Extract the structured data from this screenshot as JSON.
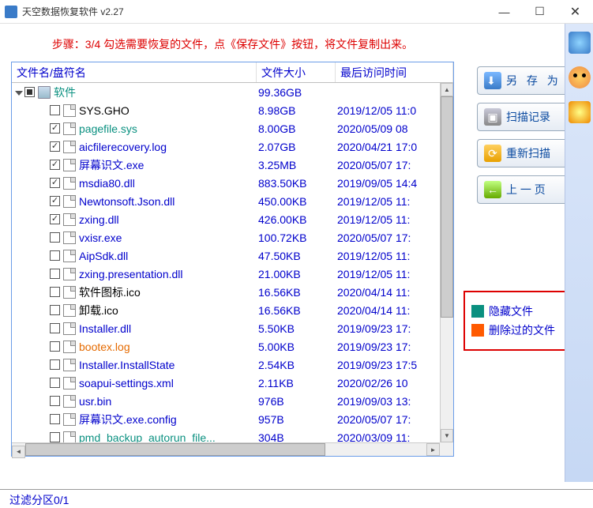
{
  "window": {
    "title": "天空数据恢复软件 v2.27"
  },
  "step_text": "步骤：3/4 勾选需要恢复的文件，点《保存文件》按钮，将文件复制出来。",
  "columns": {
    "name": "文件名/盘符名",
    "size": "文件大小",
    "time": "最后访问时间"
  },
  "root": {
    "label": "软件",
    "size": "99.36GB"
  },
  "files": [
    {
      "chk": "none",
      "name": "SYS.GHO",
      "size": "8.98GB",
      "time": "2019/12/05 11:0",
      "cls": "c-black"
    },
    {
      "chk": "checked",
      "name": "pagefile.sys",
      "size": "8.00GB",
      "time": "2020/05/09 08",
      "cls": "c-green"
    },
    {
      "chk": "checked",
      "name": "aicfilerecovery.log",
      "size": "2.07GB",
      "time": "2020/04/21 17:0",
      "cls": "c-blue"
    },
    {
      "chk": "checked",
      "name": "屏幕识文.exe",
      "size": "3.25MB",
      "time": "2020/05/07 17:",
      "cls": "c-blue"
    },
    {
      "chk": "checked",
      "name": "msdia80.dll",
      "size": "883.50KB",
      "time": "2019/09/05 14:4",
      "cls": "c-blue"
    },
    {
      "chk": "checked",
      "name": "Newtonsoft.Json.dll",
      "size": "450.00KB",
      "time": "2019/12/05 11:",
      "cls": "c-blue"
    },
    {
      "chk": "checked",
      "name": "zxing.dll",
      "size": "426.00KB",
      "time": "2019/12/05 11:",
      "cls": "c-blue"
    },
    {
      "chk": "none",
      "name": "vxisr.exe",
      "size": "100.72KB",
      "time": "2020/05/07 17:",
      "cls": "c-blue"
    },
    {
      "chk": "none",
      "name": "AipSdk.dll",
      "size": "47.50KB",
      "time": "2019/12/05 11:",
      "cls": "c-blue"
    },
    {
      "chk": "none",
      "name": "zxing.presentation.dll",
      "size": "21.00KB",
      "time": "2019/12/05 11:",
      "cls": "c-blue"
    },
    {
      "chk": "none",
      "name": "软件图标.ico",
      "size": "16.56KB",
      "time": "2020/04/14 11:",
      "cls": "c-black"
    },
    {
      "chk": "none",
      "name": "卸载.ico",
      "size": "16.56KB",
      "time": "2020/04/14 11:",
      "cls": "c-black"
    },
    {
      "chk": "none",
      "name": "Installer.dll",
      "size": "5.50KB",
      "time": "2019/09/23 17:",
      "cls": "c-blue"
    },
    {
      "chk": "none",
      "name": "bootex.log",
      "size": "5.00KB",
      "time": "2019/09/23 17:",
      "cls": "c-orange"
    },
    {
      "chk": "none",
      "name": "Installer.InstallState",
      "size": "2.54KB",
      "time": "2019/09/23 17:5",
      "cls": "c-blue"
    },
    {
      "chk": "none",
      "name": "soapui-settings.xml",
      "size": "2.11KB",
      "time": "2020/02/26 10",
      "cls": "c-blue"
    },
    {
      "chk": "none",
      "name": "usr.bin",
      "size": "976B",
      "time": "2019/09/03 13:",
      "cls": "c-blue"
    },
    {
      "chk": "none",
      "name": "屏幕识文.exe.config",
      "size": "957B",
      "time": "2020/05/07 17:",
      "cls": "c-blue"
    },
    {
      "chk": "none",
      "name": "pmd_backup_autorun_file...",
      "size": "304B",
      "time": "2020/03/09 11:",
      "cls": "c-green"
    }
  ],
  "buttons": {
    "save": "另 存 为",
    "scanlog": "扫描记录",
    "rescan": "重新扫描",
    "prev": "上 一 页"
  },
  "legend": {
    "hidden": "隐藏文件",
    "deleted": "删除过的文件"
  },
  "status": "过滤分区0/1"
}
